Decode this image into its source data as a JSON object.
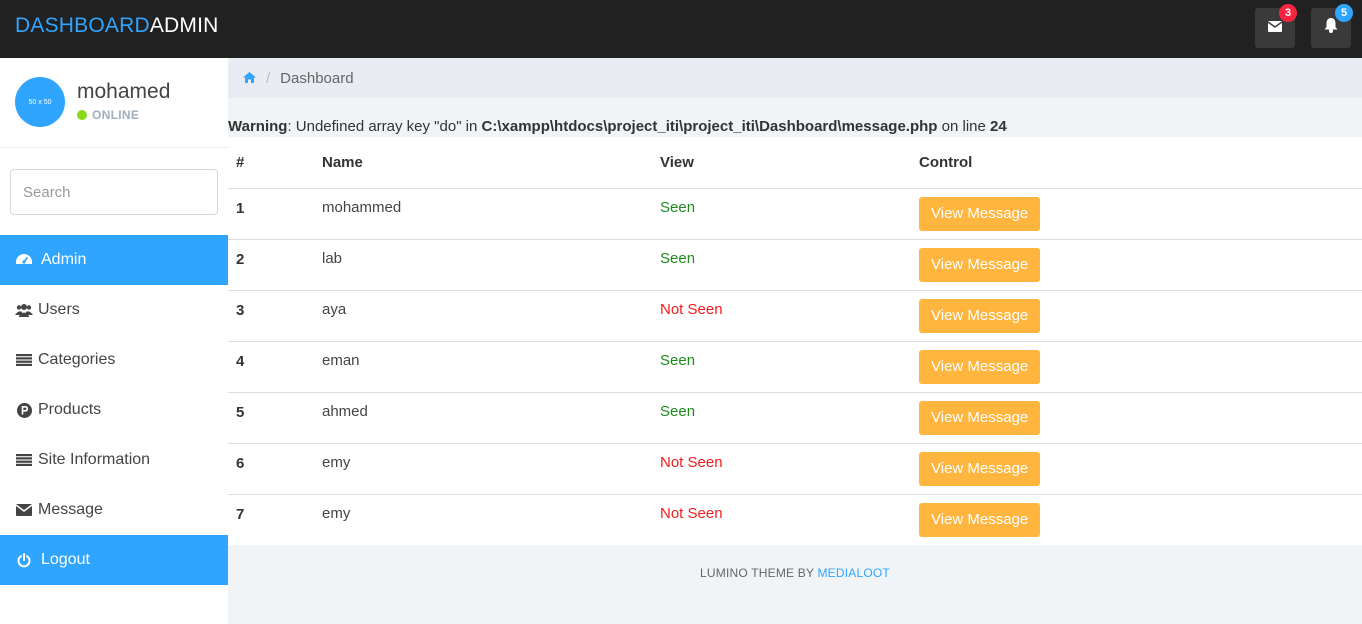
{
  "brand": {
    "part1": "DASHBOARD",
    "part2": "ADMIN"
  },
  "nav": {
    "mail_icon": "envelope-icon",
    "mail_badge": "3",
    "bell_icon": "bell-icon",
    "notif_badge": "5",
    "accent": "#30a5ff",
    "badge_red": "#f9243f"
  },
  "profile": {
    "avatar_text": "50 x 50",
    "name": "mohamed",
    "status": "ONLINE"
  },
  "search": {
    "placeholder": "Search"
  },
  "menu": [
    {
      "label": "Admin",
      "icon": "dashboard-icon",
      "active": true
    },
    {
      "label": "Users",
      "icon": "users-icon"
    },
    {
      "label": "Categories",
      "icon": "list-icon"
    },
    {
      "label": "Products",
      "icon": "product-icon"
    },
    {
      "label": "Site Information",
      "icon": "list-icon"
    },
    {
      "label": "Message",
      "icon": "envelope-icon"
    },
    {
      "label": "Logout",
      "icon": "power-icon",
      "active": true
    }
  ],
  "breadcrumb": {
    "home_icon": "home-icon",
    "current": "Dashboard"
  },
  "warning": {
    "label": "Warning",
    "message": ": Undefined array key \"do\" in ",
    "path": "C:\\xampp\\htdocs\\project_iti\\project_iti\\Dashboard\\message.php",
    "on_line": " on line ",
    "line": "24"
  },
  "table": {
    "headers": [
      "#",
      "Name",
      "View",
      "Control"
    ],
    "button_label": "View Message",
    "rows": [
      {
        "num": "1",
        "name": "mohammed",
        "view": "Seen"
      },
      {
        "num": "2",
        "name": "lab",
        "view": "Seen"
      },
      {
        "num": "3",
        "name": "aya",
        "view": "Not Seen"
      },
      {
        "num": "4",
        "name": "eman",
        "view": "Seen"
      },
      {
        "num": "5",
        "name": "ahmed",
        "view": "Seen"
      },
      {
        "num": "6",
        "name": "emy",
        "view": "Not Seen"
      },
      {
        "num": "7",
        "name": "emy",
        "view": "Not Seen"
      }
    ]
  },
  "footer": {
    "text": "LUMINO THEME BY ",
    "link": "MEDIALOOT"
  }
}
